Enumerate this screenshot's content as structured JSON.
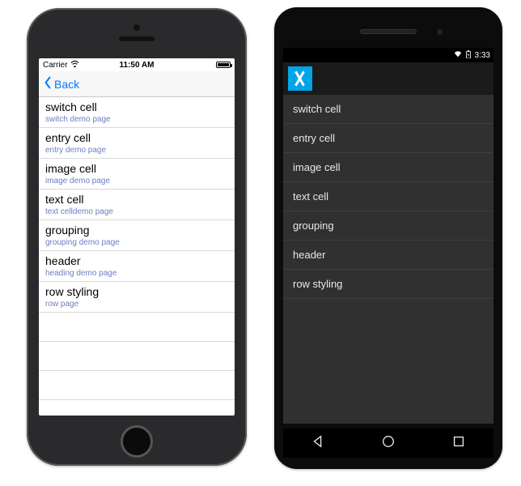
{
  "ios": {
    "status": {
      "carrier": "Carrier",
      "time": "11:50 AM"
    },
    "nav": {
      "back_label": "Back"
    },
    "items": [
      {
        "title": "switch cell",
        "detail": "switch demo page"
      },
      {
        "title": "entry cell",
        "detail": "entry demo page"
      },
      {
        "title": "image cell",
        "detail": "image demo page"
      },
      {
        "title": "text cell",
        "detail": "text celldemo page"
      },
      {
        "title": "grouping",
        "detail": "grouping demo page"
      },
      {
        "title": "header",
        "detail": "heading demo page"
      },
      {
        "title": "row styling",
        "detail": "row page"
      }
    ]
  },
  "android": {
    "status": {
      "time": "3:33"
    },
    "items": [
      {
        "title": "switch cell"
      },
      {
        "title": "entry cell"
      },
      {
        "title": "image cell"
      },
      {
        "title": "text cell"
      },
      {
        "title": "grouping"
      },
      {
        "title": "header"
      },
      {
        "title": "row styling"
      }
    ]
  }
}
